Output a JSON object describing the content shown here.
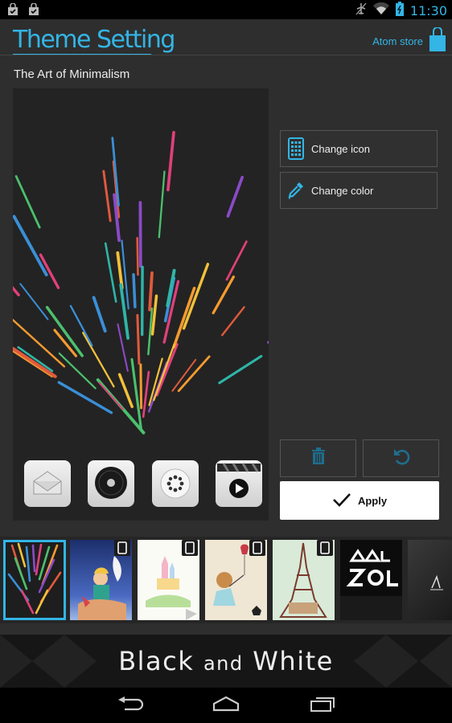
{
  "status_bar": {
    "time": "11:30"
  },
  "header": {
    "title": "Theme Setting",
    "store_label": "Atom store"
  },
  "theme_name": "The Art of Minimalism",
  "side_buttons": {
    "change_icon": "Change icon",
    "change_color": "Change color"
  },
  "apply_label": "Apply",
  "banner": {
    "word1": "Black",
    "word2": "and",
    "word3": "White"
  },
  "thumbnails": [
    {
      "name": "the-art-of-minimalism",
      "selected": true,
      "badge": false
    },
    {
      "name": "little-prince",
      "selected": false,
      "badge": true
    },
    {
      "name": "fairy-castle",
      "selected": false,
      "badge": true
    },
    {
      "name": "girl-with-balloon",
      "selected": false,
      "badge": true
    },
    {
      "name": "eiffel-tower",
      "selected": false,
      "badge": true
    },
    {
      "name": "black-and-white-typography",
      "selected": false,
      "badge": false
    },
    {
      "name": "dark-texture",
      "selected": false,
      "badge": false
    }
  ],
  "colors": {
    "accent": "#33b5e5",
    "background": "#2e2e2e"
  }
}
